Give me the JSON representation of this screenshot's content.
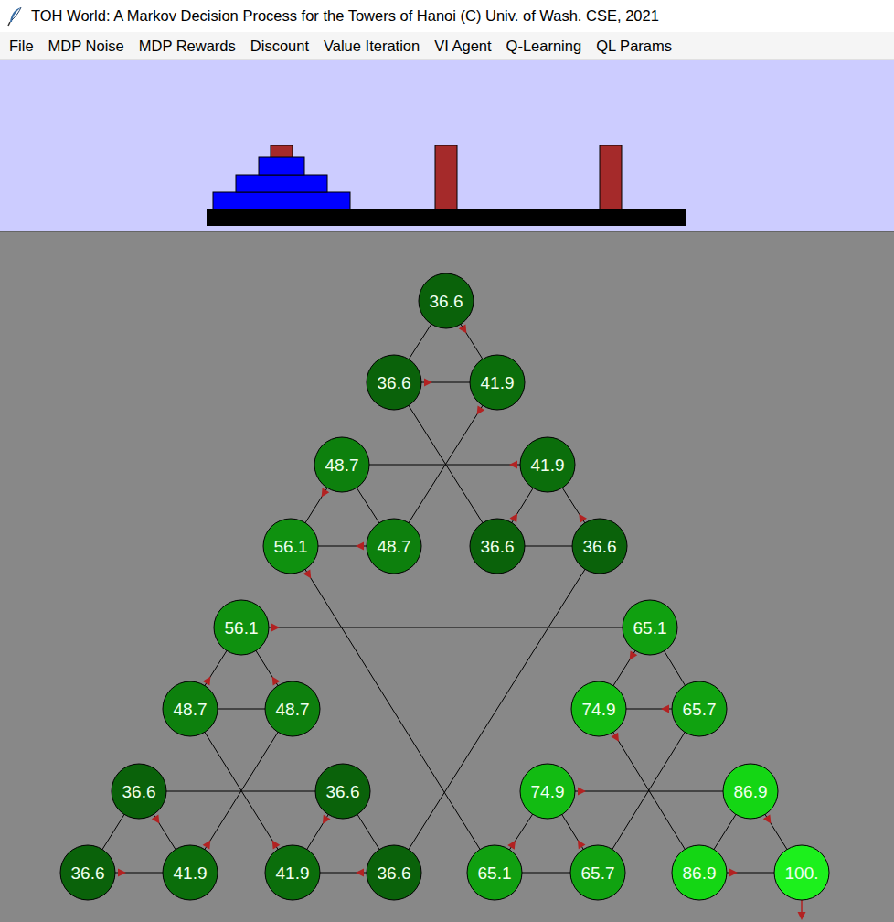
{
  "window": {
    "title": "TOH World: A Markov Decision Process for the Towers of Hanoi (C) Univ. of Wash. CSE, 2021"
  },
  "menu": [
    "File",
    "MDP Noise",
    "MDP Rewards",
    "Discount",
    "Value Iteration",
    "VI Agent",
    "Q-Learning",
    "QL Params"
  ],
  "towers": {
    "pegs": [
      {
        "disks": [
          3,
          2,
          1
        ]
      },
      {
        "disks": []
      },
      {
        "disks": []
      }
    ]
  },
  "graph": {
    "nodes": [
      {
        "value": "36.6",
        "color": "#0a620a",
        "policy": 2
      },
      {
        "value": "36.6",
        "color": "#0a620a",
        "policy": 2
      },
      {
        "value": "41.9",
        "color": "#0b6e0b",
        "policy": 6
      },
      {
        "value": "48.7",
        "color": "#0d800d",
        "policy": 5
      },
      {
        "value": "41.9",
        "color": "#0b6e0b",
        "policy": 3
      },
      {
        "value": "56.1",
        "color": "#0f910f",
        "policy": 23
      },
      {
        "value": "48.7",
        "color": "#0d800d",
        "policy": 5
      },
      {
        "value": "36.6",
        "color": "#0a620a",
        "policy": 4
      },
      {
        "value": "36.6",
        "color": "#0a620a",
        "policy": 4
      },
      {
        "value": "56.1",
        "color": "#0f910f",
        "policy": 10
      },
      {
        "value": "65.1",
        "color": "#10a010",
        "policy": 13
      },
      {
        "value": "48.7",
        "color": "#0d800d",
        "policy": 9
      },
      {
        "value": "48.7",
        "color": "#0d800d",
        "policy": 9
      },
      {
        "value": "74.9",
        "color": "#12bb12",
        "policy": 25
      },
      {
        "value": "65.7",
        "color": "#10a210",
        "policy": 13
      },
      {
        "value": "36.6",
        "color": "#0a620a",
        "policy": 20
      },
      {
        "value": "36.6",
        "color": "#0a620a",
        "policy": 21
      },
      {
        "value": "74.9",
        "color": "#12bb12",
        "policy": 18
      },
      {
        "value": "86.9",
        "color": "#14d614",
        "policy": 26
      },
      {
        "value": "36.6",
        "color": "#0a620a",
        "policy": 20
      },
      {
        "value": "41.9",
        "color": "#0b6e0b",
        "policy": 12
      },
      {
        "value": "41.9",
        "color": "#0b6e0b",
        "policy": 11
      },
      {
        "value": "36.6",
        "color": "#0a620a",
        "policy": 21
      },
      {
        "value": "65.1",
        "color": "#10a010",
        "policy": 17
      },
      {
        "value": "65.7",
        "color": "#10a210",
        "policy": 17
      },
      {
        "value": "86.9",
        "color": "#14d614",
        "policy": 26
      },
      {
        "value": "100.",
        "color": "#1cf01c",
        "policy": "exit"
      }
    ],
    "edges": [
      [
        0,
        1
      ],
      [
        0,
        2
      ],
      [
        1,
        2
      ],
      [
        1,
        7
      ],
      [
        2,
        6
      ],
      [
        3,
        4
      ],
      [
        3,
        5
      ],
      [
        3,
        6
      ],
      [
        5,
        6
      ],
      [
        4,
        7
      ],
      [
        4,
        8
      ],
      [
        7,
        8
      ],
      [
        5,
        23
      ],
      [
        8,
        22
      ],
      [
        9,
        10
      ],
      [
        9,
        11
      ],
      [
        9,
        12
      ],
      [
        11,
        12
      ],
      [
        10,
        13
      ],
      [
        10,
        14
      ],
      [
        13,
        14
      ],
      [
        11,
        21
      ],
      [
        12,
        20
      ],
      [
        13,
        25
      ],
      [
        14,
        24
      ],
      [
        15,
        16
      ],
      [
        17,
        18
      ],
      [
        15,
        19
      ],
      [
        15,
        20
      ],
      [
        19,
        20
      ],
      [
        16,
        21
      ],
      [
        16,
        22
      ],
      [
        21,
        22
      ],
      [
        17,
        23
      ],
      [
        17,
        24
      ],
      [
        23,
        24
      ],
      [
        18,
        25
      ],
      [
        18,
        26
      ],
      [
        25,
        26
      ]
    ]
  }
}
